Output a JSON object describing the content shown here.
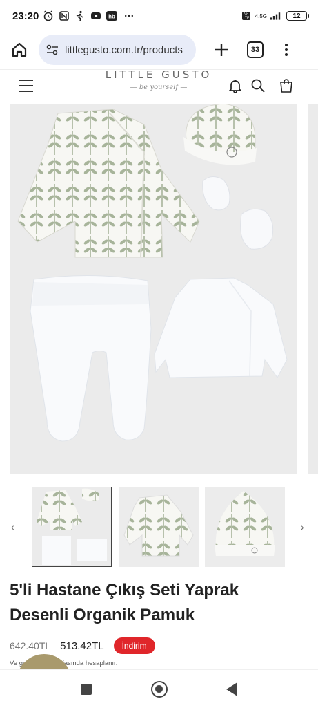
{
  "status_bar": {
    "time": "23:20",
    "network": "4.5G",
    "battery": "12"
  },
  "browser": {
    "url": "littlegusto.com.tr/products",
    "tab_count": "33"
  },
  "site": {
    "logo_main": "LITTLE GUSTO",
    "logo_tagline": "be yourself"
  },
  "product": {
    "title": "5'li Hastane Çıkış Seti Yaprak Desenli Organik Pamuk",
    "old_price": "642.40TL",
    "new_price": "513.42TL",
    "badge": "İndirim",
    "tax_note": "Ve                           go, ödeme sayfasında hesaplanır."
  },
  "icons": {
    "home": "home-icon",
    "site_settings": "tune-icon",
    "new_tab": "plus-icon",
    "menu": "more-vert-icon",
    "bell": "bell-icon",
    "search": "search-icon",
    "bag": "shopping-bag-icon"
  },
  "colors": {
    "badge_red": "#e0262a",
    "url_bg": "#e8ecf8",
    "leaf_green": "#a7b49a"
  }
}
